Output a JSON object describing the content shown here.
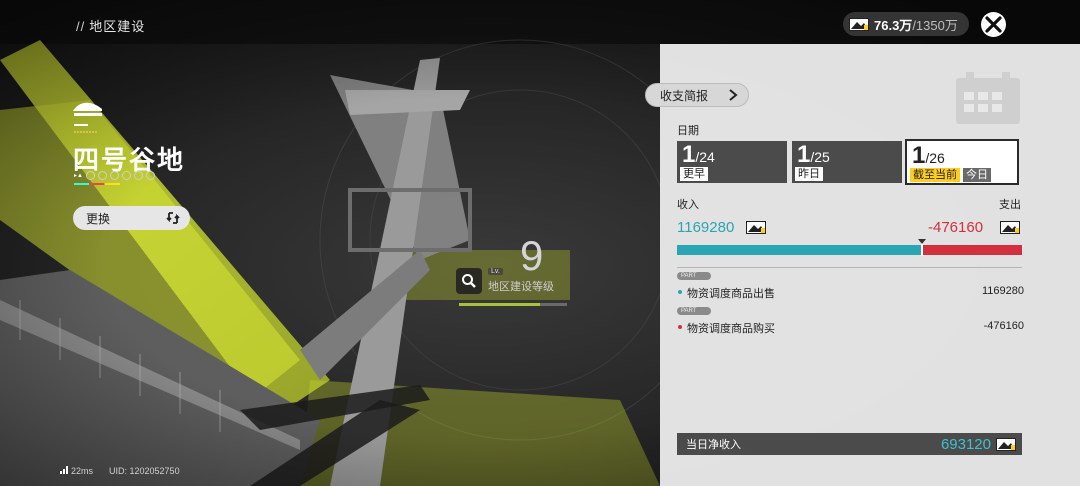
{
  "header": {
    "breadcrumb": "地区建设",
    "currency_current": "76.3万",
    "currency_max": "/1350万"
  },
  "region": {
    "name": "四号谷地",
    "switch_label": "更换",
    "level_number": "9",
    "level_tag": "Lv.",
    "level_label": "地区建设等级",
    "level_progress": 0.75
  },
  "footer": {
    "ping": "22ms",
    "uid": "UID: 1202052750"
  },
  "panel": {
    "brief_button": "收支简报",
    "date_title": "日期",
    "dates": [
      {
        "day": "1",
        "month": "/24",
        "sub": "更早"
      },
      {
        "day": "1",
        "month": "/25",
        "sub": "昨日"
      },
      {
        "day": "1",
        "month": "/26",
        "sub": "截至当前",
        "sub2": "今日"
      }
    ],
    "income_label": "收入",
    "expense_label": "支出",
    "income_value": "1169280",
    "expense_value": "-476160",
    "income_ratio": 0.71,
    "rows": [
      {
        "tag": "PART",
        "label": "物资调度商品出售",
        "value": "1169280",
        "color": "#2aa5b3"
      },
      {
        "tag": "PART",
        "label": "物资调度商品购买",
        "value": "-476160",
        "color": "#d3303f"
      }
    ],
    "net_label": "当日净收入",
    "net_value": "693120"
  },
  "colors": {
    "income": "#2aa5b3",
    "expense": "#d3303f",
    "accent_yellow": "#e3f23a",
    "today_tag": "#ffce1f"
  }
}
